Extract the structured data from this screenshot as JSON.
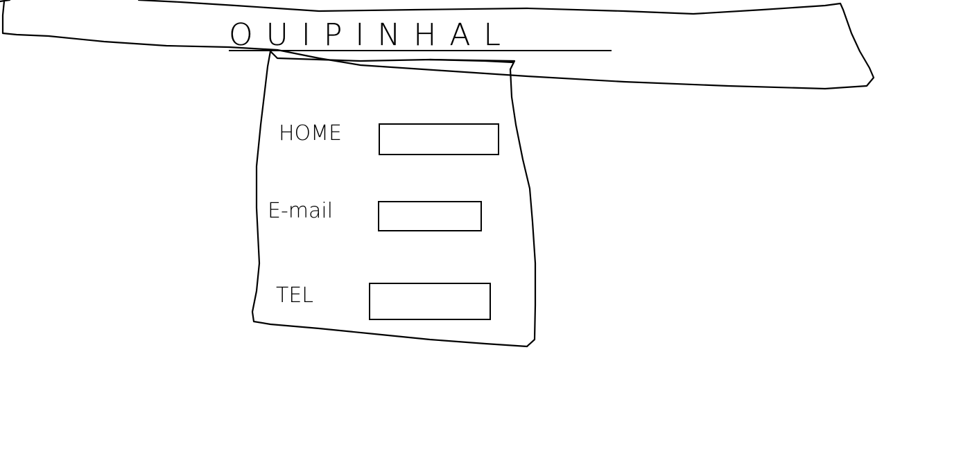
{
  "header": {
    "title": "OUIPINHAL"
  },
  "form": {
    "fields": [
      {
        "label": "HOME",
        "value": "",
        "placeholder": ""
      },
      {
        "label": "E-mail",
        "value": "",
        "placeholder": ""
      },
      {
        "label": "TEL",
        "value": "",
        "placeholder": ""
      }
    ]
  },
  "colors": {
    "ink": "#000000",
    "background": "#ffffff"
  }
}
